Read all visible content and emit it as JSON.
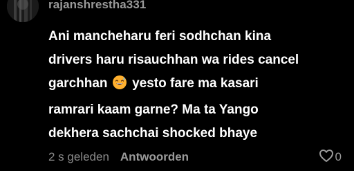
{
  "comment": {
    "username": "rajanshrestha331",
    "text_lines": [
      "Ani mancheharu feri sodhchan kina",
      "drivers haru risauchhan wa rides cancel",
      "garchhan",
      "yesto fare ma kasari",
      "ramrari kaam garne? Ma ta Yango",
      "dekhera sachchai shocked bhaye"
    ],
    "emoji": "sweat-smile-emoji",
    "timestamp": "2 s geleden",
    "reply_label": "Antwoorden",
    "like_icon": "heart-outline-icon",
    "like_count": "0"
  },
  "colors": {
    "background": "#000000",
    "text": "#ffffff",
    "muted": "#8a8a8a",
    "emoji": "#ffb02e"
  }
}
